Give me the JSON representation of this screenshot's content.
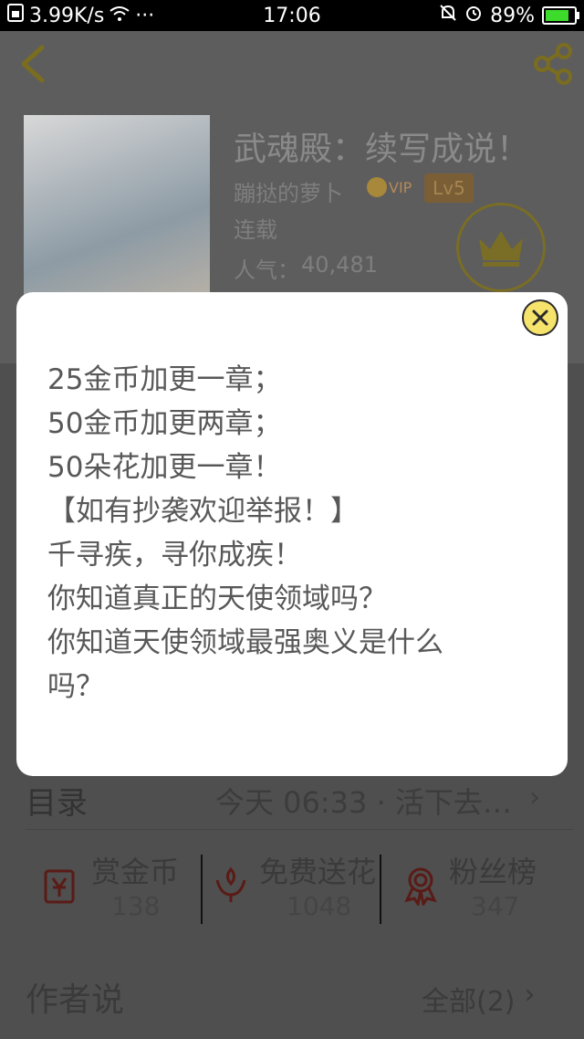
{
  "status_bar": {
    "network_speed": "3.99K/s",
    "more": "···",
    "time": "17:06",
    "battery_percent": "89%",
    "battery_level": 0.89
  },
  "book": {
    "title": "武魂殿：续写成说！",
    "author": "蹦挞的萝卜",
    "vip": "VIP",
    "level": "Lv5",
    "status": "连载",
    "popularity_label": "人气：",
    "popularity_value": "40,481"
  },
  "catalog": {
    "label": "目录",
    "latest": "今天 06:33 · 活下去…",
    "arrow": "›"
  },
  "stats": [
    {
      "label": "赏金币",
      "value": "138",
      "icon": "coin-reward-icon"
    },
    {
      "label": "免费送花",
      "value": "1048",
      "icon": "flower-icon"
    },
    {
      "label": "粉丝榜",
      "value": "347",
      "icon": "medal-icon"
    }
  ],
  "author_says": {
    "label": "作者说",
    "all": "全部(2)",
    "arrow": "›"
  },
  "dialog": {
    "lines": [
      "25金币加更一章；",
      "50金币加更两章；",
      "50朵花加更一章！",
      "【如有抄袭欢迎举报！】",
      "千寻疾，寻你成疾！",
      "你知道真正的天使领域吗？",
      "你知道天使领域最强奥义是什么",
      "吗？"
    ]
  },
  "colors": {
    "accent_yellow": "#f6e36c",
    "overlay_bg": "#5d5d5d",
    "dialog_text": "#585858"
  }
}
